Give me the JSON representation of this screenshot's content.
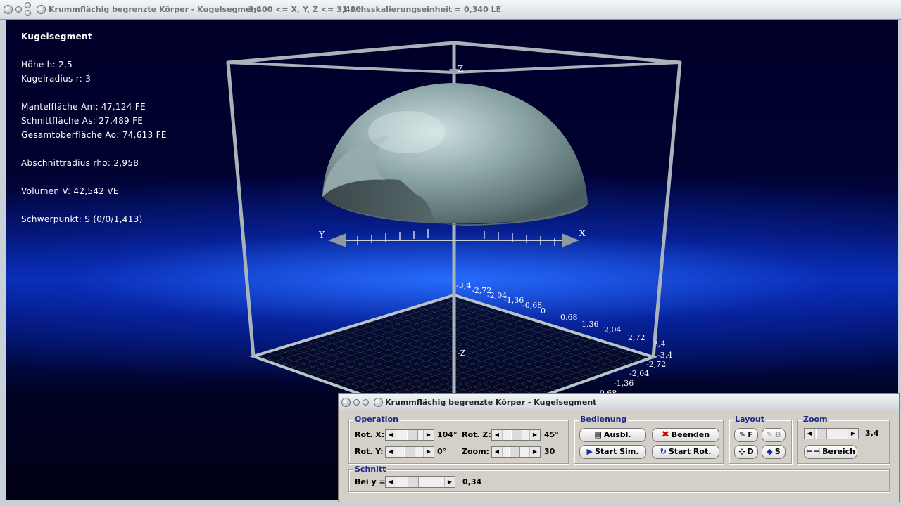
{
  "window": {
    "title": "Krummflächig begrenzte Körper - Kugelsegment",
    "range": "-3,400 <= X, Y, Z <= 3,400",
    "scale": "1 Achsskalierungseinheit = 0,340 LE"
  },
  "info": {
    "heading": "Kugelsegment",
    "lines": [
      "Höhe h: 2,5",
      "Kugelradius r: 3",
      "Mantelfläche Am: 47,124 FE",
      "Schnittfläche As: 27,489 FE",
      "Gesamtoberfläche Ao: 74,613 FE",
      "Abschnittradius rho: 2,958",
      "Volumen V: 42,542 VE",
      "Schwerpunkt: S (0/0/1,413)"
    ]
  },
  "axes": {
    "x": "X",
    "y": "Y",
    "z": "Z",
    "neg_z": "-Z",
    "ticks_back": [
      "-3,4",
      "-2,72",
      "-2,04",
      "-1,36",
      "-0,68",
      "0",
      "0,68",
      "1,36",
      "2,04",
      "2,72",
      "3,4"
    ],
    "ticks_right": [
      "-3,4",
      "-2,72",
      "-2,04",
      "-1,36",
      "-0,68"
    ]
  },
  "panel": {
    "title": "Krummflächig begrenzte Körper - Kugelsegment",
    "operation": {
      "label": "Operation",
      "rot_x_label": "Rot. X:",
      "rot_x_value": "104°",
      "rot_z_label": "Rot. Z:",
      "rot_z_value": "45°",
      "rot_y_label": "Rot. Y:",
      "rot_y_value": "0°",
      "zoom_label": "Zoom:",
      "zoom_value": "30"
    },
    "bedienung": {
      "label": "Bedienung",
      "ausbl": "Ausbl.",
      "beenden": "Beenden",
      "start_sim": "Start Sim.",
      "start_rot": "Start Rot."
    },
    "layout": {
      "label": "Layout",
      "f": "F",
      "b": "B",
      "d": "D",
      "s": "S"
    },
    "zoom": {
      "label": "Zoom",
      "value": "3,4",
      "bereich": "Bereich"
    },
    "schnitt": {
      "label": "Schnitt",
      "bei_y_label": "Bei y =",
      "bei_y_value": "0,34"
    }
  }
}
